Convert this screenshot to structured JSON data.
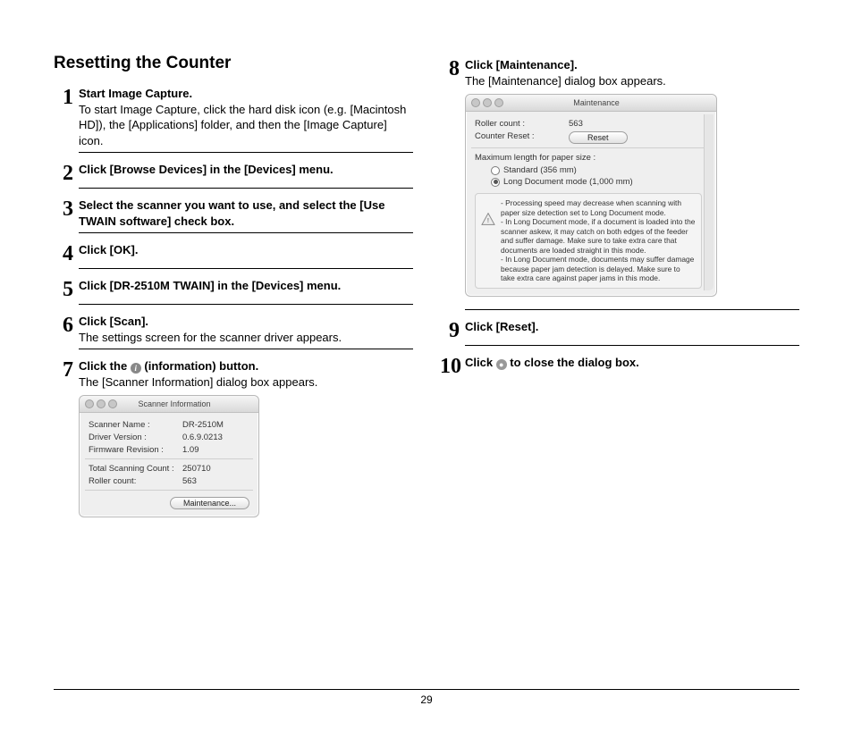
{
  "document": {
    "section_title": "Resetting the Counter",
    "page_number": "29"
  },
  "steps": [
    {
      "num": "1",
      "title": "Start Image Capture.",
      "desc": "To start Image Capture, click the hard disk icon (e.g. [Macintosh HD]), the [Applications] folder, and then the [Image Capture] icon."
    },
    {
      "num": "2",
      "title": "Click [Browse Devices] in the [Devices] menu.",
      "desc": ""
    },
    {
      "num": "3",
      "title": "Select the scanner you want to use, and select the [Use TWAIN software] check box.",
      "desc": ""
    },
    {
      "num": "4",
      "title": "Click [OK].",
      "desc": ""
    },
    {
      "num": "5",
      "title": "Click [DR-2510M TWAIN] in the [Devices] menu.",
      "desc": ""
    },
    {
      "num": "6",
      "title": "Click [Scan].",
      "desc": "The settings screen for the scanner driver appears."
    },
    {
      "num": "7",
      "title_before": "Click the ",
      "title_after": " (information) button.",
      "desc": "The [Scanner Information] dialog box appears."
    },
    {
      "num": "8",
      "title": "Click [Maintenance].",
      "desc": "The [Maintenance] dialog box appears."
    },
    {
      "num": "9",
      "title": "Click [Reset].",
      "desc": ""
    },
    {
      "num": "10",
      "title_before": "Click ",
      "title_after": " to close the dialog box.",
      "desc": ""
    }
  ],
  "scanner_info_dialog": {
    "title": "Scanner Information",
    "rows": [
      {
        "key": "Scanner Name :",
        "value": "DR-2510M"
      },
      {
        "key": "Driver Version :",
        "value": "0.6.9.0213"
      },
      {
        "key": "Firmware Revision :",
        "value": "1.09"
      },
      {
        "key": "Total Scanning Count :",
        "value": "250710"
      },
      {
        "key": "Roller count:",
        "value": "563"
      }
    ],
    "maintenance_button": "Maintenance..."
  },
  "maintenance_dialog": {
    "title": "Maintenance",
    "roller_count_label": "Roller count :",
    "roller_count_value": "563",
    "counter_reset_label": "Counter Reset :",
    "reset_button": "Reset",
    "max_length_label": "Maximum length for paper size :",
    "radio_standard": "Standard (356 mm)",
    "radio_long": "Long Document mode (1,000 mm)",
    "note_text": "- Processing speed may decrease when scanning with paper size detection set to Long Document mode.\n- In Long Document mode, if a document is loaded into the scanner askew, it may catch on both edges of the feeder and suffer damage. Make sure to take extra care that documents are loaded straight in this mode.\n- In Long Document mode, documents may suffer damage because paper jam detection is delayed. Make sure to take extra care against paper jams in this mode."
  }
}
